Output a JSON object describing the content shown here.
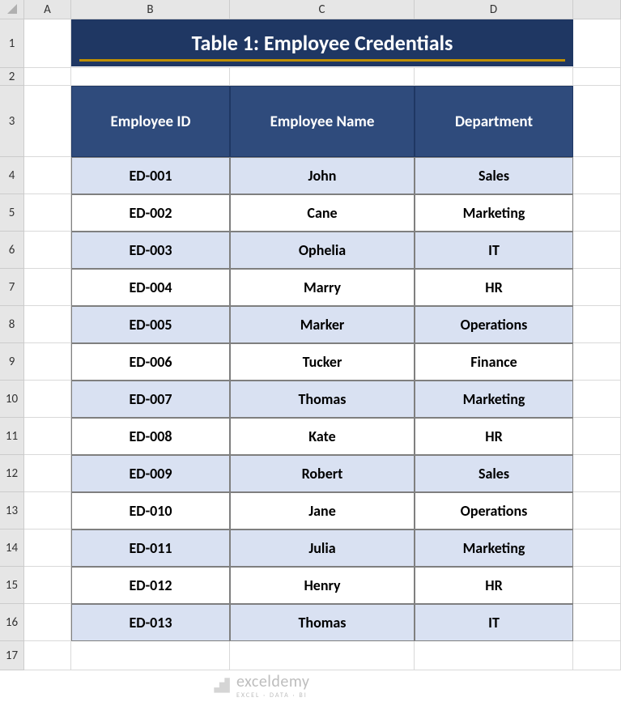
{
  "columns": [
    "A",
    "B",
    "C",
    "D"
  ],
  "row_numbers": [
    "1",
    "2",
    "3",
    "4",
    "5",
    "6",
    "7",
    "8",
    "9",
    "10",
    "11",
    "12",
    "13",
    "14",
    "15",
    "16",
    "17"
  ],
  "title": "Table 1: Employee Credentials",
  "headers": {
    "b": "Employee ID",
    "c": "Employee Name",
    "d": "Department"
  },
  "rows": [
    {
      "id": "ED-001",
      "name": "John",
      "dept": "Sales"
    },
    {
      "id": "ED-002",
      "name": "Cane",
      "dept": "Marketing"
    },
    {
      "id": "ED-003",
      "name": "Ophelia",
      "dept": "IT"
    },
    {
      "id": "ED-004",
      "name": "Marry",
      "dept": "HR"
    },
    {
      "id": "ED-005",
      "name": "Marker",
      "dept": "Operations"
    },
    {
      "id": "ED-006",
      "name": "Tucker",
      "dept": "Finance"
    },
    {
      "id": "ED-007",
      "name": "Thomas",
      "dept": "Marketing"
    },
    {
      "id": "ED-008",
      "name": "Kate",
      "dept": "HR"
    },
    {
      "id": "ED-009",
      "name": "Robert",
      "dept": "Sales"
    },
    {
      "id": "ED-010",
      "name": "Jane",
      "dept": "Operations"
    },
    {
      "id": "ED-011",
      "name": "Julia",
      "dept": "Marketing"
    },
    {
      "id": "ED-012",
      "name": "Henry",
      "dept": "HR"
    },
    {
      "id": "ED-013",
      "name": "Thomas",
      "dept": "IT"
    }
  ],
  "watermark": {
    "brand": "exceldemy",
    "tagline": "EXCEL · DATA · BI"
  },
  "chart_data": {
    "type": "table",
    "title": "Table 1: Employee Credentials",
    "columns": [
      "Employee ID",
      "Employee Name",
      "Department"
    ],
    "rows": [
      [
        "ED-001",
        "John",
        "Sales"
      ],
      [
        "ED-002",
        "Cane",
        "Marketing"
      ],
      [
        "ED-003",
        "Ophelia",
        "IT"
      ],
      [
        "ED-004",
        "Marry",
        "HR"
      ],
      [
        "ED-005",
        "Marker",
        "Operations"
      ],
      [
        "ED-006",
        "Tucker",
        "Finance"
      ],
      [
        "ED-007",
        "Thomas",
        "Marketing"
      ],
      [
        "ED-008",
        "Kate",
        "HR"
      ],
      [
        "ED-009",
        "Robert",
        "Sales"
      ],
      [
        "ED-010",
        "Jane",
        "Operations"
      ],
      [
        "ED-011",
        "Julia",
        "Marketing"
      ],
      [
        "ED-012",
        "Henry",
        "HR"
      ],
      [
        "ED-013",
        "Thomas",
        "IT"
      ]
    ]
  }
}
